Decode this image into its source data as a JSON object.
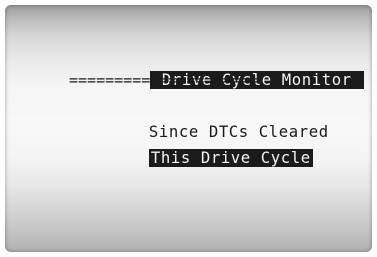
{
  "screen": {
    "title": " Drive Cycle Monitor ",
    "divider": "=====================",
    "menu": [
      {
        "label": "Since DTCs Cleared",
        "selected": false
      },
      {
        "label": "This Drive Cycle",
        "selected": true
      }
    ]
  }
}
